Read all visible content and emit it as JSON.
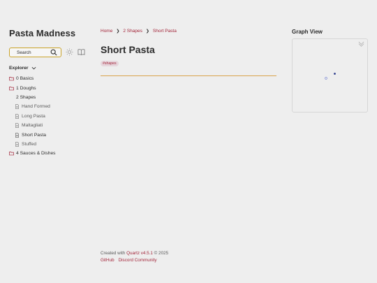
{
  "site": {
    "title": "Pasta Madness"
  },
  "search": {
    "label": "Search"
  },
  "explorer": {
    "title": "Explorer",
    "items": [
      {
        "label": "0 Basics",
        "type": "folder"
      },
      {
        "label": "1 Doughs",
        "type": "folder"
      },
      {
        "label": "2 Shapes",
        "type": "open-folder",
        "children": [
          "Hand Formed",
          "Long Pasta",
          "Maltagliati",
          "Short Pasta",
          "Stuffed"
        ]
      },
      {
        "label": "4 Sauces & Dishes",
        "type": "folder"
      }
    ]
  },
  "breadcrumb": {
    "items": [
      "Home",
      "2 Shapes",
      "Short Pasta"
    ]
  },
  "page": {
    "title": "Short Pasta",
    "tag": "#shapes"
  },
  "graph": {
    "title": "Graph View"
  },
  "footer": {
    "created_prefix": "Created with",
    "quartz": "Quartz v4.5.1",
    "year": "© 2025",
    "links": [
      "GitHub",
      "Discord Community"
    ]
  },
  "colors": {
    "accent": "#a3263a",
    "highlight": "#d9a44c",
    "background": "#eeeeee",
    "node": "#2d3c8c"
  }
}
